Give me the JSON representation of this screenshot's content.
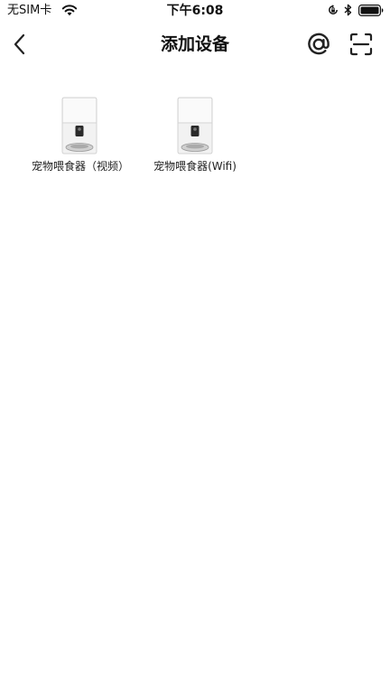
{
  "status_bar": {
    "carrier": "无SIM卡",
    "time": "下午6:08",
    "icons": [
      "wifi-icon",
      "orientation-lock-icon",
      "bluetooth-icon",
      "battery-icon"
    ]
  },
  "nav": {
    "title": "添加设备",
    "back_icon": "chevron-left-icon",
    "right_icons": [
      "at-sign-icon",
      "scan-icon"
    ]
  },
  "devices": [
    {
      "label": "宠物喂食器（视频）",
      "icon": "pet-feeder-image"
    },
    {
      "label": "宠物喂食器(Wifi)",
      "icon": "pet-feeder-image"
    }
  ],
  "colors": {
    "background": "#ffffff",
    "text": "#1a1a1a",
    "device_body": "#f2f2f2"
  }
}
